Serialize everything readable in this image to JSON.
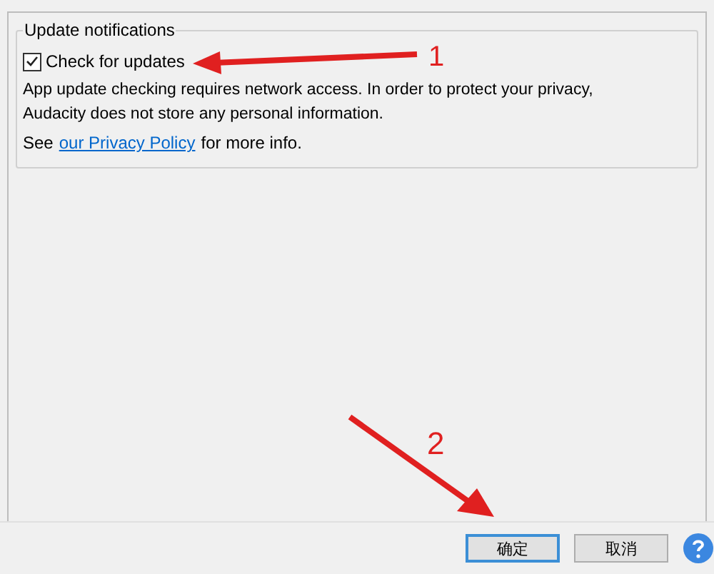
{
  "group": {
    "title": "Update notifications",
    "checkbox": {
      "label": "Check for updates",
      "checked": true
    },
    "description": [
      "App update checking requires network access. In order to protect your privacy,",
      "Audacity does not store any personal information."
    ],
    "privacy": {
      "before": "See",
      "link": "our Privacy Policy",
      "after": "for more info."
    }
  },
  "buttons": [
    {
      "label": "确定",
      "selected": true
    },
    {
      "label": "取消",
      "selected": false
    }
  ],
  "annotations": [
    {
      "label": "1"
    },
    {
      "label": "2"
    }
  ]
}
